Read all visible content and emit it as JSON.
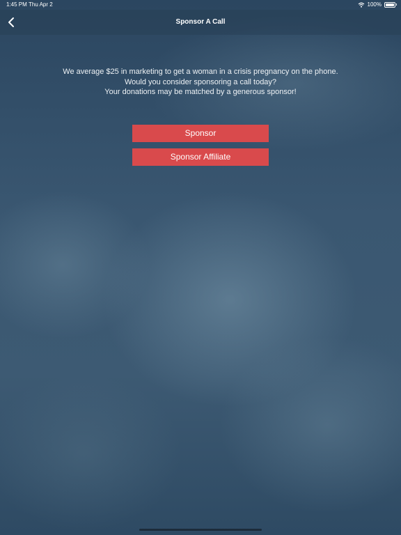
{
  "status_bar": {
    "time": "1:45 PM",
    "date": "Thu Apr 2",
    "battery": "100%",
    "icons": [
      "wifi-icon",
      "battery-icon"
    ]
  },
  "nav": {
    "title": "Sponsor A Call",
    "back_icon": "chevron-left-icon"
  },
  "main": {
    "message_lines": [
      "We average $25 in marketing to get a woman in a crisis pregnancy on the phone.",
      "Would you consider sponsoring a call today?",
      "Your donations may be matched by a generous sponsor!"
    ],
    "buttons": {
      "sponsor": "Sponsor",
      "sponsor_affiliate": "Sponsor Affiliate"
    }
  },
  "colors": {
    "accent": "#d94a4c",
    "background": "#3a5771"
  }
}
